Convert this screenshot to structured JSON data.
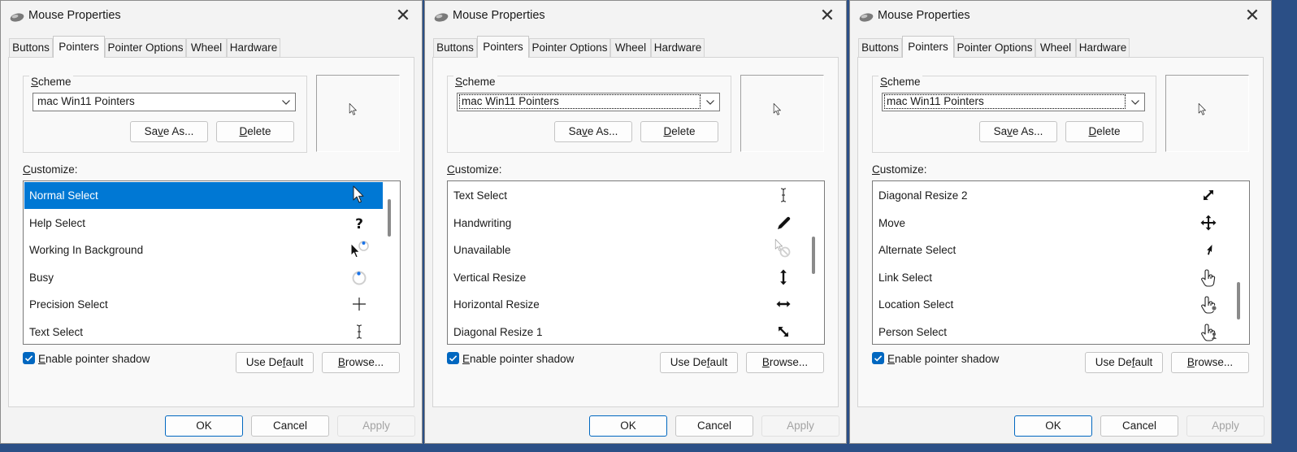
{
  "window": {
    "title": "Mouse Properties",
    "close_glyph": "✕",
    "icon": "mouse-icon"
  },
  "tabs": [
    "Buttons",
    "Pointers",
    "Pointer Options",
    "Wheel",
    "Hardware"
  ],
  "active_tab": "Pointers",
  "scheme": {
    "group_label": "Scheme",
    "selected": "mac Win11 Pointers",
    "save_as_label": "Save As...",
    "delete_label": "Delete"
  },
  "customize_label": "Customize:",
  "enable_shadow": {
    "label": "Enable pointer shadow",
    "checked": true
  },
  "use_default_label": "Use Default",
  "browse_label": "Browse...",
  "footer": {
    "ok": "OK",
    "cancel": "Cancel",
    "apply": "Apply"
  },
  "colors": {
    "accent": "#0067c0",
    "selection": "#0078d4"
  },
  "dialogs": [
    {
      "scheme_focused": false,
      "scroll_position_fraction": 0.0,
      "rows": [
        {
          "label": "Normal Select",
          "icon": "arrow-cursor-icon",
          "selected": true
        },
        {
          "label": "Help Select",
          "icon": "help-cursor-icon"
        },
        {
          "label": "Working In Background",
          "icon": "working-cursor-icon"
        },
        {
          "label": "Busy",
          "icon": "busy-cursor-icon"
        },
        {
          "label": "Precision Select",
          "icon": "crosshair-cursor-icon"
        },
        {
          "label": "Text Select",
          "icon": "text-cursor-icon"
        }
      ]
    },
    {
      "scheme_focused": true,
      "scroll_position_fraction": 0.45,
      "rows": [
        {
          "label": "Text Select",
          "icon": "text-cursor-icon"
        },
        {
          "label": "Handwriting",
          "icon": "pen-cursor-icon"
        },
        {
          "label": "Unavailable",
          "icon": "unavailable-cursor-icon"
        },
        {
          "label": "Vertical Resize",
          "icon": "vertical-resize-icon"
        },
        {
          "label": "Horizontal Resize",
          "icon": "horizontal-resize-icon"
        },
        {
          "label": "Diagonal Resize 1",
          "icon": "diagonal-resize-1-icon"
        }
      ]
    },
    {
      "scheme_focused": true,
      "scroll_position_fraction": 1.0,
      "rows": [
        {
          "label": "Diagonal Resize 2",
          "icon": "diagonal-resize-2-icon"
        },
        {
          "label": "Move",
          "icon": "move-cursor-icon"
        },
        {
          "label": "Alternate Select",
          "icon": "alternate-select-icon"
        },
        {
          "label": "Link Select",
          "icon": "link-hand-icon"
        },
        {
          "label": "Location Select",
          "icon": "location-hand-icon"
        },
        {
          "label": "Person Select",
          "icon": "person-hand-icon"
        }
      ]
    }
  ]
}
